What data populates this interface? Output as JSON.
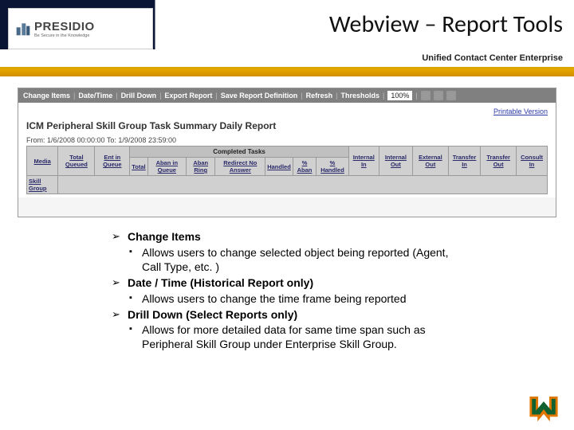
{
  "header": {
    "logo_main": "PRESIDIO",
    "logo_tag": "Be Secure in the Knowledge",
    "title": "Webview – Report Tools"
  },
  "subheader": {
    "text": "Unified Contact Center Enterprise"
  },
  "screenshot": {
    "toolbar_items": [
      "Change Items",
      "Date/Time",
      "Drill Down",
      "Export Report",
      "Save Report Definition",
      "Refresh",
      "Thresholds"
    ],
    "zoom": "100%",
    "print_link": "Printable Version",
    "report_title": "ICM Peripheral Skill Group Task Summary Daily Report",
    "date_range": "From: 1/6/2008 00:00:00 To: 1/9/2008 23:59:00",
    "group_header": "Completed Tasks",
    "cols_left": [
      "Media",
      "Skill Group"
    ],
    "cols_mid": [
      "Total Queued",
      "Ent in Queue"
    ],
    "cols_completed": [
      "Total",
      "Aban in Queue",
      "Aban Ring",
      "Redirect No Answer",
      "Handled",
      "% Aban",
      "% Handled"
    ],
    "cols_right": [
      "Internal In",
      "Internal Out",
      "External Out",
      "Transfer In",
      "Transfer Out",
      "Consult In"
    ]
  },
  "bullets": [
    {
      "title": "Change Items",
      "desc": "Allows users to change selected object being reported (Agent, Call Type, etc. )"
    },
    {
      "title": "Date / Time (Historical Report only)",
      "desc": "Allows users to change the time frame being reported"
    },
    {
      "title": "Drill Down (Select Reports only)",
      "desc": " Allows for more detailed data for same time span such as Peripheral Skill Group under Enterprise Skill Group."
    }
  ]
}
